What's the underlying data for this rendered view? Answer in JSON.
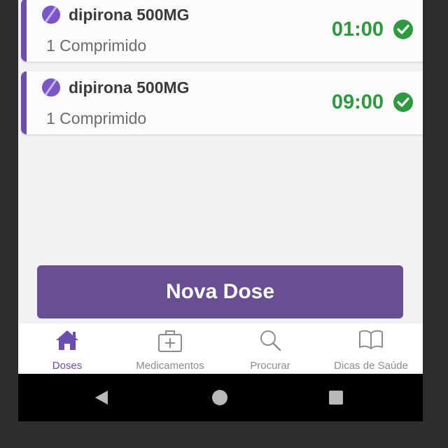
{
  "doses": [
    {
      "name": "dipirona 500MG",
      "quantity": "1 Comprimido",
      "time": "01:00",
      "status_icon": "check-circle-icon"
    },
    {
      "name": "dipirona 500MG",
      "quantity": "1 Comprimido",
      "time": "09:00",
      "status_icon": "check-circle-icon"
    }
  ],
  "actions": {
    "new_dose_label": "Nova Dose"
  },
  "bottom_nav": {
    "items": [
      {
        "label": "Doses",
        "icon": "home-icon",
        "active": true
      },
      {
        "label": "Medicamentos",
        "icon": "first-aid-kit-icon",
        "active": false
      },
      {
        "label": "Procurar",
        "icon": "search-icon",
        "active": false
      },
      {
        "label": "Dicas de Saúde",
        "icon": "book-icon",
        "active": false
      }
    ]
  },
  "system_nav": {
    "buttons": [
      "back",
      "home",
      "recent-apps"
    ]
  },
  "colors": {
    "accent_purple": "#674f92",
    "card_border_purple": "#6b4fae",
    "taken_green": "#2e9a3e",
    "screen_background": "#f2f2f4"
  }
}
